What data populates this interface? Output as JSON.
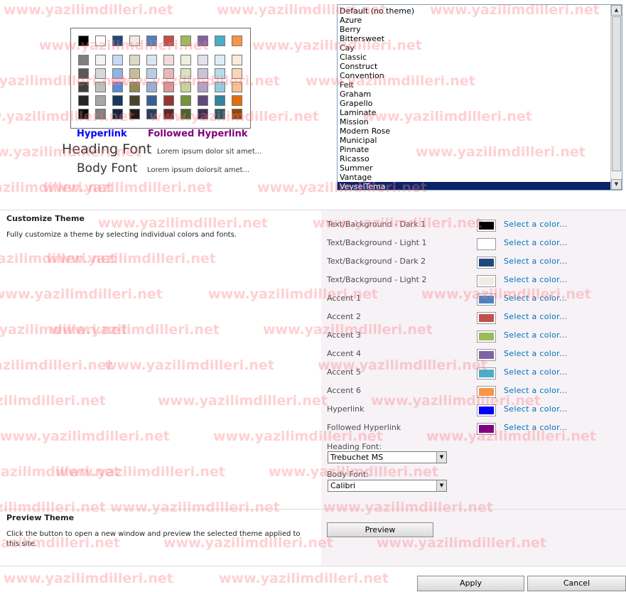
{
  "preview": {
    "swatch_top_row": [
      "#000000",
      "#ffffff",
      "#1f497d",
      "#eeece1",
      "#4f81bd",
      "#c0504d",
      "#9bbb59",
      "#8064a2",
      "#4bacc6",
      "#f79646"
    ],
    "swatch_grid": [
      [
        "#7f7f7f",
        "#f2f2f2",
        "#c6d9f1",
        "#ddd9c4",
        "#dbe5f1",
        "#f2dcdb",
        "#ebf1de",
        "#e5e0ec",
        "#dbeef4",
        "#fdeada"
      ],
      [
        "#595959",
        "#d9d9d9",
        "#8eb4e3",
        "#c4bd97",
        "#b9cde5",
        "#e6b9b8",
        "#d7e4bd",
        "#ccc1da",
        "#b7dee8",
        "#fcd5b5"
      ],
      [
        "#404040",
        "#bfbfbf",
        "#558ed5",
        "#948a54",
        "#95b3d7",
        "#d99694",
        "#c3d69b",
        "#b3a2c7",
        "#93cddd",
        "#fac090"
      ],
      [
        "#262626",
        "#a6a6a6",
        "#17375e",
        "#4a452a",
        "#376092",
        "#953735",
        "#77933c",
        "#604a7b",
        "#31859c",
        "#e46c0a"
      ],
      [
        "#0d0d0d",
        "#808080",
        "#10253f",
        "#1e1c11",
        "#254061",
        "#632523",
        "#4f6228",
        "#403152",
        "#215968",
        "#984807"
      ]
    ],
    "hyperlink_label": "Hyperlink",
    "followed_hyperlink_label": "Followed Hyperlink",
    "heading_font_label": "Heading Font",
    "heading_lorem": "Lorem ipsum dolor sit amet...",
    "body_font_label": "Body Font",
    "body_lorem": "Lorem ipsum dolorsit amet...",
    "hyperlink_color": "#0000ff",
    "followed_color": "#800080"
  },
  "themes": {
    "items": [
      "Default (no theme)",
      "Azure",
      "Berry",
      "Bittersweet",
      "Cay",
      "Classic",
      "Construct",
      "Convention",
      "Felt",
      "Graham",
      "Grapello",
      "Laminate",
      "Mission",
      "Modern Rose",
      "Municipal",
      "Pinnate",
      "Ricasso",
      "Summer",
      "Vantage",
      "VeyselTema"
    ],
    "selected": "VeyselTema"
  },
  "customize": {
    "title": "Customize Theme",
    "description": "Fully customize a theme by selecting individual colors and fonts.",
    "select_link": "Select a color...",
    "rows": [
      {
        "label": "Text/Background - Dark 1",
        "color": "#000000"
      },
      {
        "label": "Text/Background - Light 1",
        "color": "#ffffff"
      },
      {
        "label": "Text/Background - Dark 2",
        "color": "#1f497d"
      },
      {
        "label": "Text/Background - Light 2",
        "color": "#eeece1"
      },
      {
        "label": "Accent 1",
        "color": "#4f81bd"
      },
      {
        "label": "Accent 2",
        "color": "#c0504d"
      },
      {
        "label": "Accent 3",
        "color": "#9bbb59"
      },
      {
        "label": "Accent 4",
        "color": "#8064a2"
      },
      {
        "label": "Accent 5",
        "color": "#4bacc6"
      },
      {
        "label": "Accent 6",
        "color": "#f79646"
      },
      {
        "label": "Hyperlink",
        "color": "#0000ff"
      },
      {
        "label": "Followed Hyperlink",
        "color": "#800080"
      }
    ],
    "heading_font_label": "Heading Font:",
    "heading_font_value": "Trebuchet MS",
    "body_font_label": "Body Font:",
    "body_font_value": "Calibri"
  },
  "preview_section": {
    "title": "Preview Theme",
    "description": "Click the button to open a new window and preview the selected theme applied to this site.",
    "button": "Preview"
  },
  "footer": {
    "apply": "Apply",
    "cancel": "Cancel"
  },
  "watermark": "www.yazilimdilleri.net"
}
